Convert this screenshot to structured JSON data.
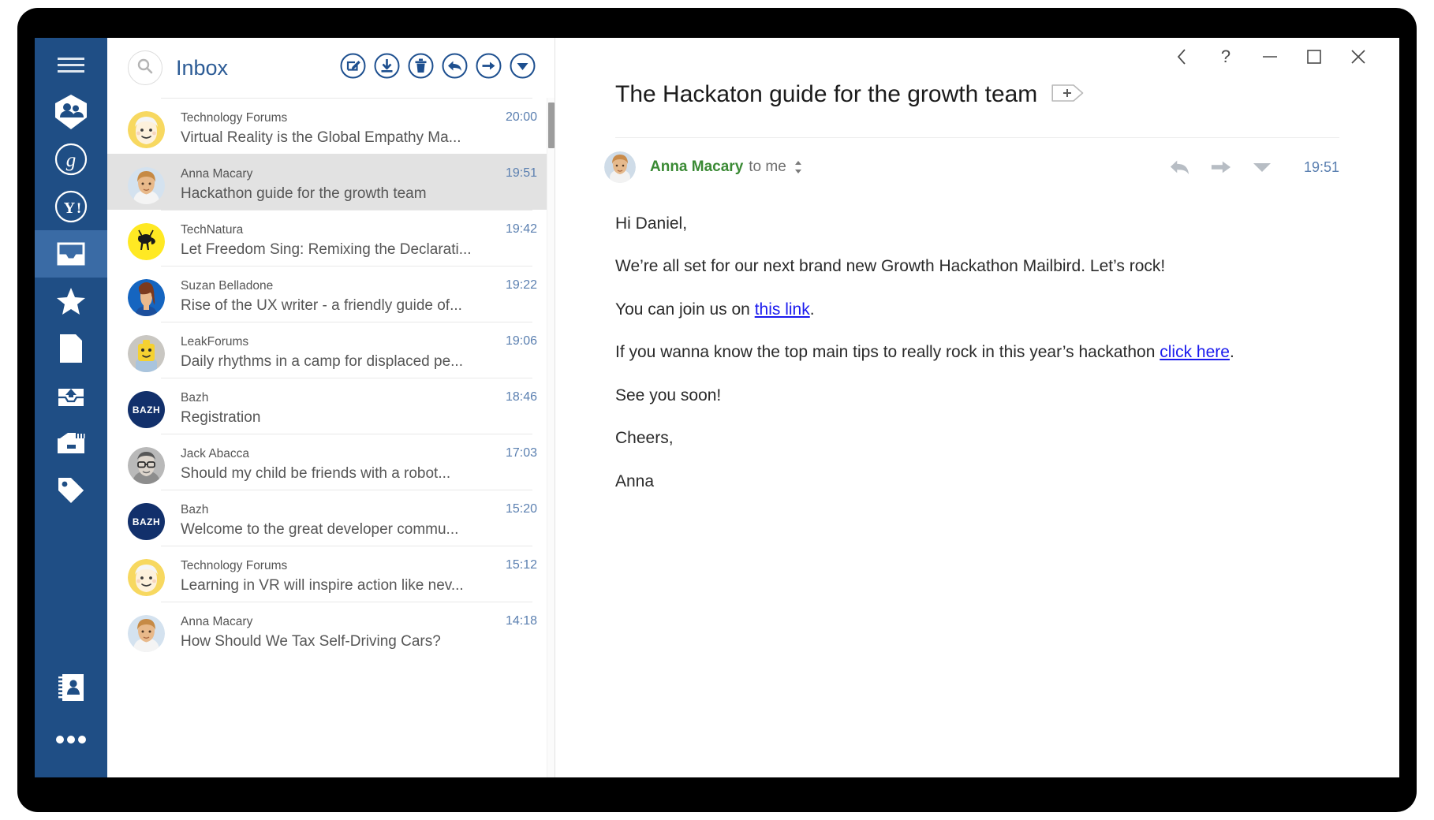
{
  "window_controls": [
    {
      "name": "back",
      "glyph": "‹"
    },
    {
      "name": "help",
      "glyph": "?"
    },
    {
      "name": "minimize",
      "glyph": "—"
    },
    {
      "name": "maximize",
      "glyph": "□"
    },
    {
      "name": "close",
      "glyph": "✕"
    }
  ],
  "sidebar": {
    "accent_color": "#1f4e85",
    "active_color": "#3a6ba5",
    "items": [
      {
        "icon": "hamburger-menu-icon",
        "label": "Menu"
      },
      {
        "icon": "unified-accounts-icon",
        "label": "All accounts"
      },
      {
        "icon": "google-account-icon",
        "label": "Google account"
      },
      {
        "icon": "yahoo-account-icon",
        "label": "Yahoo account"
      },
      {
        "icon": "inbox-icon",
        "label": "Inbox",
        "active": true
      },
      {
        "icon": "star-icon",
        "label": "Starred"
      },
      {
        "icon": "drafts-icon",
        "label": "Drafts"
      },
      {
        "icon": "sent-icon",
        "label": "Sent"
      },
      {
        "icon": "archive-icon",
        "label": "Archive"
      },
      {
        "icon": "tag-icon",
        "label": "Labels"
      }
    ],
    "bottom_items": [
      {
        "icon": "contacts-book-icon",
        "label": "Contacts"
      },
      {
        "icon": "more-options-icon",
        "label": "More"
      }
    ]
  },
  "list_toolbar": {
    "search_icon": "search-icon",
    "folder_title": "Inbox",
    "actions": [
      {
        "icon": "compose-icon",
        "label": "Compose"
      },
      {
        "icon": "archive-download-icon",
        "label": "Archive"
      },
      {
        "icon": "delete-trash-icon",
        "label": "Delete"
      },
      {
        "icon": "reply-icon",
        "label": "Reply"
      },
      {
        "icon": "forward-icon",
        "label": "Forward"
      },
      {
        "icon": "more-dropdown-icon",
        "label": "More actions"
      }
    ]
  },
  "accent_blue": "#2d5c96",
  "time_blue": "#5a7fb0",
  "emails": [
    {
      "sender": "Technology Forums",
      "subject": "Virtual Reality is the Global Empathy Ma...",
      "time": "20:00",
      "avatar_type": "face-yellow",
      "selected": false
    },
    {
      "sender": "Anna Macary",
      "subject": "Hackathon guide for the growth team",
      "time": "19:51",
      "avatar_type": "photo-anna",
      "selected": true
    },
    {
      "sender": "TechNatura",
      "subject": "Let Freedom Sing: Remixing the Declarati...",
      "time": "19:42",
      "avatar_type": "deer-yellow",
      "selected": false
    },
    {
      "sender": "Suzan Belladone",
      "subject": "Rise of the UX writer - a friendly guide of...",
      "time": "19:22",
      "avatar_type": "photo-suzan",
      "selected": false
    },
    {
      "sender": "LeakForums",
      "subject": "Daily rhythms in a camp for displaced pe...",
      "time": "19:06",
      "avatar_type": "lego",
      "selected": false
    },
    {
      "sender": "Bazh",
      "subject": "Registration",
      "time": "18:46",
      "avatar_type": "initials-bazh",
      "initials": "BAZH",
      "selected": false
    },
    {
      "sender": "Jack Abacca",
      "subject": "Should my child be friends with a robot...",
      "time": "17:03",
      "avatar_type": "photo-jack",
      "selected": false
    },
    {
      "sender": "Bazh",
      "subject": "Welcome to the great developer commu...",
      "time": "15:20",
      "avatar_type": "initials-bazh",
      "initials": "BAZH",
      "selected": false
    },
    {
      "sender": "Technology Forums",
      "subject": "Learning in VR will inspire action like nev...",
      "time": "15:12",
      "avatar_type": "face-yellow",
      "selected": false
    },
    {
      "sender": "Anna Macary",
      "subject": "How Should We Tax Self-Driving Cars?",
      "time": "14:18",
      "avatar_type": "photo-anna",
      "selected": false
    }
  ],
  "reader": {
    "subject": "The Hackaton guide for the growth team",
    "add_tag_icon": "add-tag-icon",
    "sender_name": "Anna Macary",
    "sender_recipient": "to me",
    "expand_icon": "expand-details-icon",
    "time": "19:51",
    "actions": [
      {
        "icon": "reply-icon",
        "label": "Reply"
      },
      {
        "icon": "forward-icon",
        "label": "Forward"
      },
      {
        "icon": "more-dropdown-icon",
        "label": "More"
      }
    ],
    "body": {
      "greeting": "Hi Daniel,",
      "p1": "We’re all set for our next brand new Growth Hackathon Mailbird. Let’s rock!",
      "p2_before": "You can join us on ",
      "p2_link": "this link",
      "p2_after": ".",
      "p3_before": "If you wanna know the top main tips to really rock in this year’s hackathon ",
      "p3_link": "click here",
      "p3_after": ".",
      "p4": "See you soon!",
      "p5": "Cheers,",
      "p6": "Anna"
    }
  }
}
